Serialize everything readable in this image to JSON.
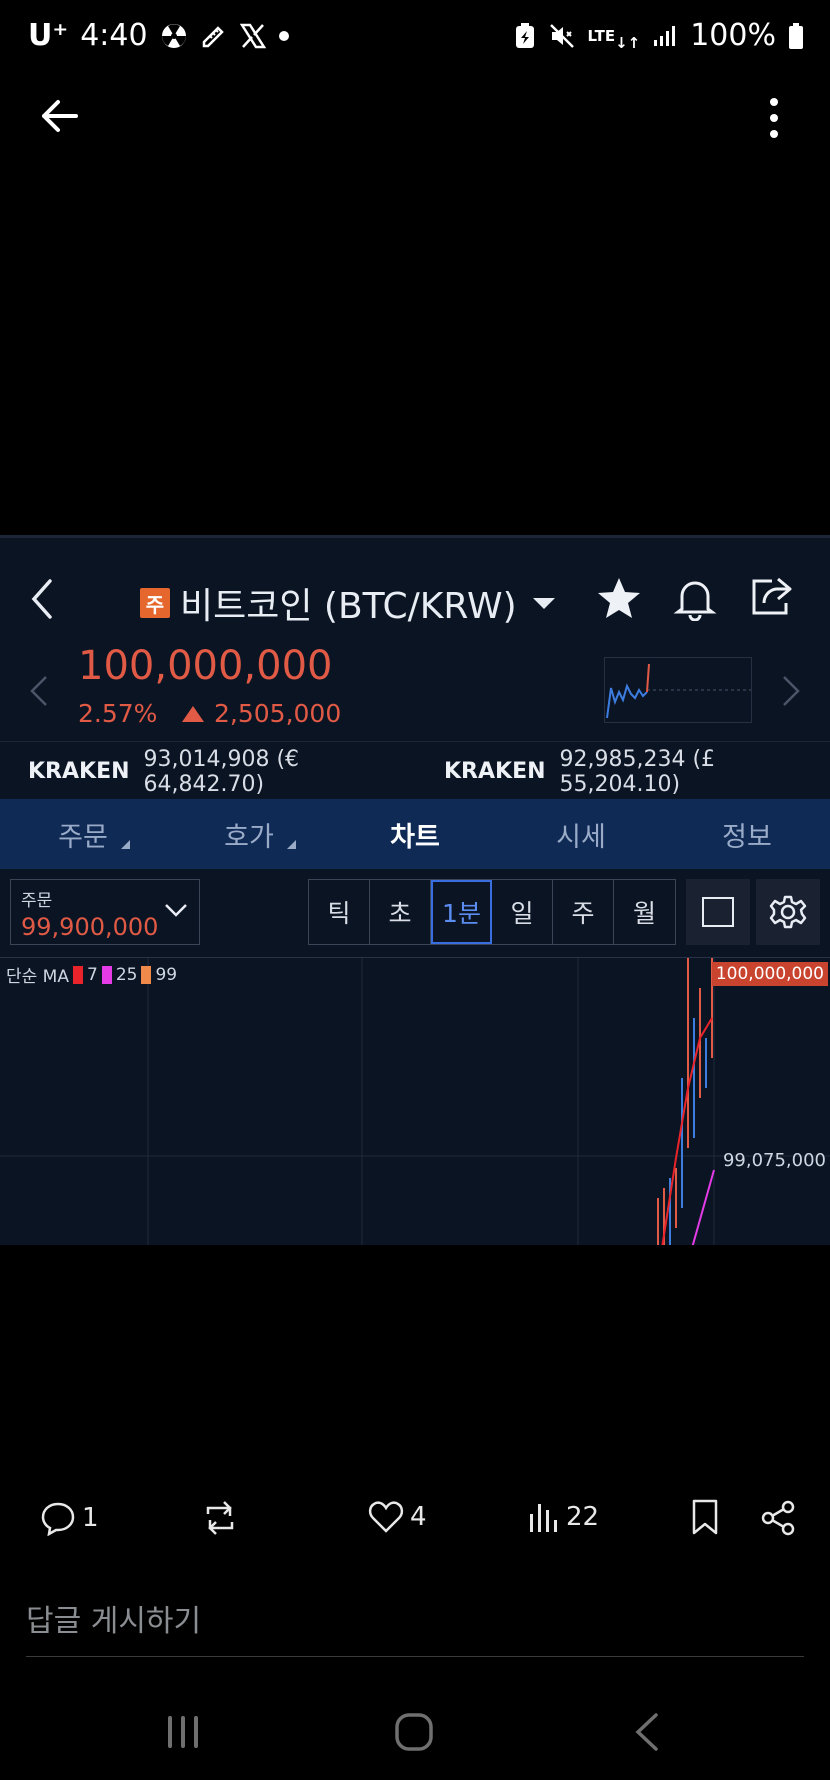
{
  "status_bar": {
    "carrier": "U⁺",
    "time": "4:40",
    "battery_text": "100%",
    "network": "LTE"
  },
  "app_bar": {
    "back_icon": "arrow-left-icon",
    "menu_icon": "more-vertical-icon"
  },
  "media": {
    "coin_badge": "주",
    "coin_title": "비트코인 (BTC/KRW)",
    "price": "100,000,000",
    "change_pct": "2.57%",
    "change_amt": "2,505,000",
    "kraken": [
      {
        "name": "KRAKEN",
        "value": "93,014,908 (€ 64,842.70)"
      },
      {
        "name": "KRAKEN",
        "value": "92,985,234 (£ 55,204.10)"
      }
    ],
    "tabs": [
      {
        "label": "주문",
        "active": false,
        "corner": true
      },
      {
        "label": "호가",
        "active": false,
        "corner": true
      },
      {
        "label": "차트",
        "active": true,
        "corner": false
      },
      {
        "label": "시세",
        "active": false,
        "corner": false
      },
      {
        "label": "정보",
        "active": false,
        "corner": false
      }
    ],
    "order": {
      "label": "주문",
      "value": "99,900,000"
    },
    "intervals": [
      {
        "label": "틱",
        "active": false
      },
      {
        "label": "초",
        "active": false
      },
      {
        "label": "1분",
        "active": true
      },
      {
        "label": "일",
        "active": false
      },
      {
        "label": "주",
        "active": false
      },
      {
        "label": "월",
        "active": false
      }
    ],
    "chart_data": {
      "type": "line",
      "legend_prefix": "단순 MA",
      "ma_periods": [
        {
          "label": "7",
          "color": "#e8242a"
        },
        {
          "label": "25",
          "color": "#e43be6"
        },
        {
          "label": "99",
          "color": "#f08a4b"
        }
      ],
      "price_tag": "100,000,000",
      "axis_label": "99,075,000"
    }
  },
  "actions": {
    "reply_count": "1",
    "like_count": "4",
    "views_count": "22",
    "reply_placeholder": "답글 게시하기"
  }
}
